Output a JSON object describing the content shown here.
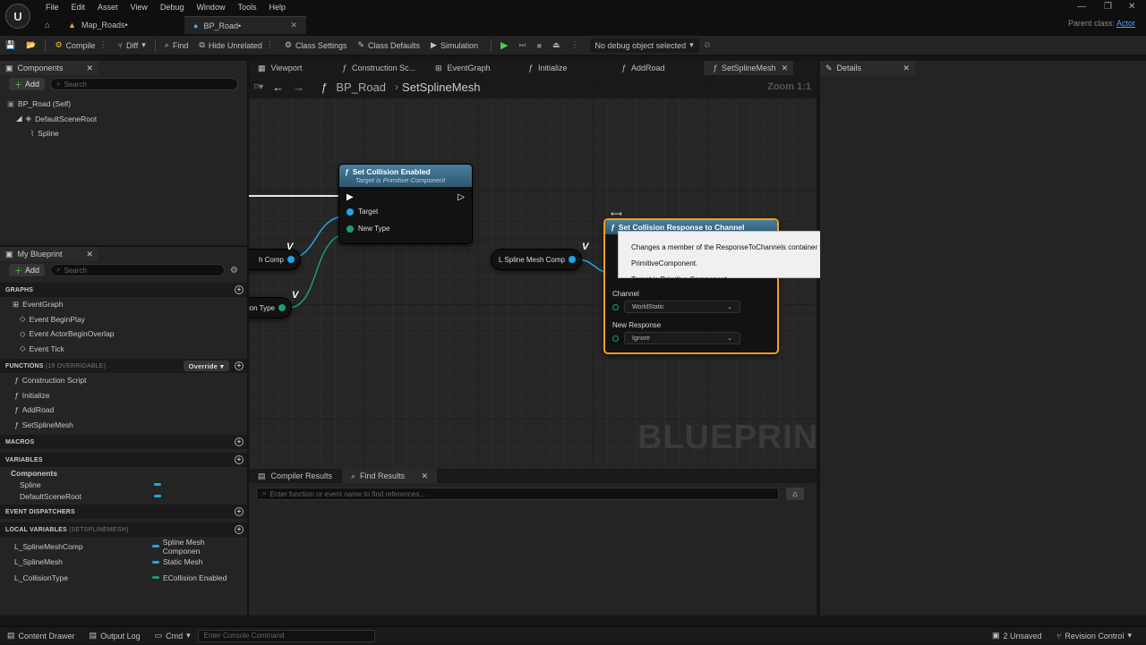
{
  "menu": [
    "File",
    "Edit",
    "Asset",
    "View",
    "Debug",
    "Window",
    "Tools",
    "Help"
  ],
  "logo": "U",
  "tabs": [
    {
      "label": "Map_Roads•"
    },
    {
      "label": "BP_Road•"
    }
  ],
  "parent_class": {
    "label": "Parent class:",
    "value": "Actor"
  },
  "toolbar": {
    "compile": "Compile",
    "diff": "Diff",
    "find": "Find",
    "hide_unrelated": "Hide Unrelated",
    "class_settings": "Class Settings",
    "class_defaults": "Class Defaults",
    "simulation": "Simulation",
    "debug_select": "No debug object selected"
  },
  "components": {
    "title": "Components",
    "add": "Add",
    "search_placeholder": "Search",
    "tree": [
      "BP_Road (Self)",
      "DefaultSceneRoot",
      "Spline"
    ]
  },
  "my_blueprint": {
    "title": "My Blueprint",
    "add": "Add",
    "search_placeholder": "Search",
    "graphs_header": "GRAPHS",
    "graphs": [
      "EventGraph",
      "Event BeginPlay",
      "Event ActorBeginOverlap",
      "Event Tick"
    ],
    "functions_header": "FUNCTIONS",
    "functions_note": "(19 OVERRIDABLE)",
    "override": "Override",
    "functions": [
      "Construction Script",
      "Initialize",
      "AddRoad",
      "SetSplineMesh"
    ],
    "macros_header": "MACROS",
    "variables_header": "VARIABLES",
    "variables_group": "Components",
    "variables": [
      "Spline",
      "DefaultSceneRoot"
    ],
    "dispatchers_header": "EVENT DISPATCHERS",
    "local_header": "LOCAL VARIABLES",
    "local_note": "(SETSPLINEMESH)",
    "locals": [
      {
        "name": "L_SplineMeshComp",
        "type": "Spline Mesh Componen",
        "color": "#21a5e6"
      },
      {
        "name": "L_SplineMesh",
        "type": "Static Mesh",
        "color": "#21a5e6"
      },
      {
        "name": "L_CollisionType",
        "type": "ECollision Enabled",
        "color": "#1f9b6d"
      }
    ]
  },
  "editor_tabs": [
    "Viewport",
    "Construction Sc...",
    "EventGraph",
    "Initialize",
    "AddRoad",
    "SetSplineMesh"
  ],
  "details_title": "Details",
  "breadcrumb": {
    "root": "BP_Road",
    "current": "SetSplineMesh",
    "zoom": "Zoom 1:1"
  },
  "graph": {
    "watermark": "BLUEPRINT",
    "node_collision": {
      "title": "Set Collision Enabled",
      "subtitle": "Target is Primitive Component",
      "pin_target": "Target",
      "pin_type": "New Type"
    },
    "node_response": {
      "title": "Set Collision Response to Channel",
      "channel_label": "Channel",
      "channel_value": "WorldStatic",
      "response_label": "New Response",
      "response_value": "Ignore"
    },
    "getter_mesh": "L Spline Mesh Comp",
    "left_getter_1": "h Comp",
    "left_getter_2": "ion Type",
    "tooltip_line1": "Changes a member of the ResponseToChannels container for this PrimitiveComponent.",
    "tooltip_line2": "Target is Primitive Component"
  },
  "bottom": {
    "tab_compiler": "Compiler Results",
    "tab_find": "Find Results",
    "search_placeholder": "Enter function or event name to find references..."
  },
  "status": {
    "content_drawer": "Content Drawer",
    "output_log": "Output Log",
    "cmd": "Cmd",
    "console_placeholder": "Enter Console Command",
    "unsaved": "2 Unsaved",
    "revision": "Revision Control"
  }
}
